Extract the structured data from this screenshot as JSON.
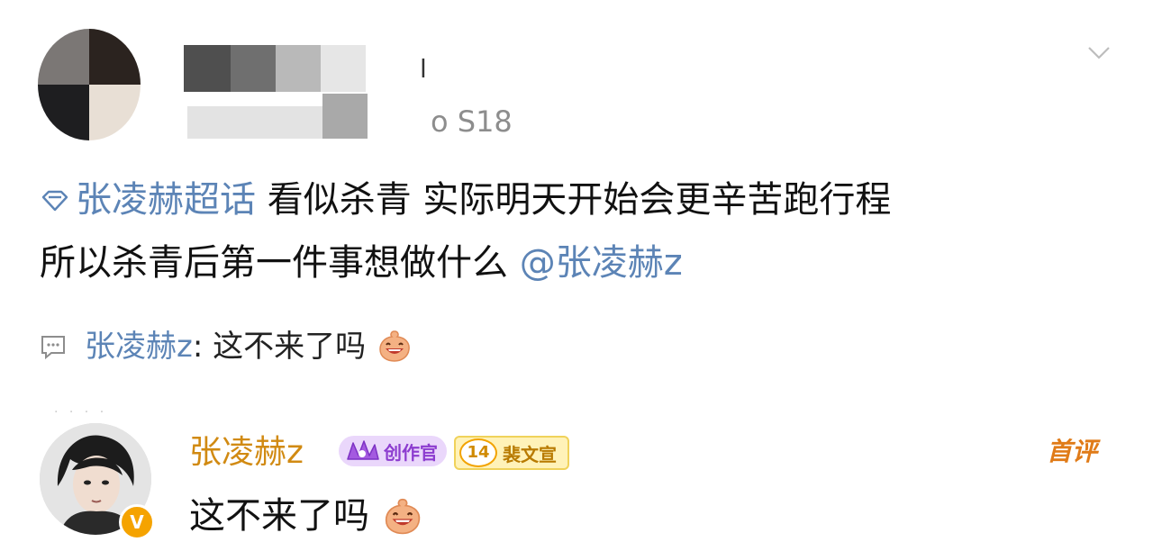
{
  "post": {
    "device_text": "o S18",
    "name_trail": "l",
    "topic": "张凌赫超话",
    "line1_text": " 看似杀青 实际明天开始会更辛苦跑行程",
    "line2_text": "所以杀青后第一件事想做什么 ",
    "mention": "@张凌赫z"
  },
  "comment_preview": {
    "author": "张凌赫z",
    "separator": ": ",
    "text": "这不来了吗"
  },
  "reply": {
    "author": "张凌赫z",
    "badge_creator": "创作官",
    "badge_level": "14",
    "badge_fan": "裴文宣",
    "first_comment_label": "首评",
    "text": "这不来了吗",
    "verified_mark": "V"
  },
  "colors": {
    "link": "#5c84b6",
    "author_gold": "#d18a12",
    "first_comment": "#e07b18",
    "badge_purple": "#8c3ccf"
  },
  "icons": [
    "chevron-down-icon",
    "topic-diamond-icon",
    "comment-icon",
    "laugh-emoji-icon",
    "verified-badge-icon"
  ]
}
